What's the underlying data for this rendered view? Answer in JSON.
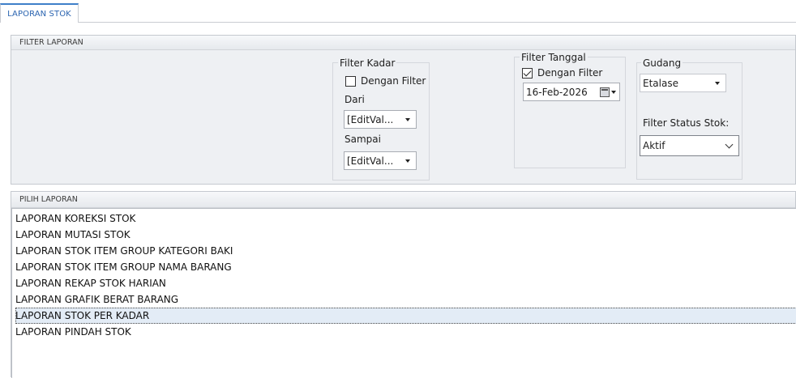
{
  "tab": {
    "label": "LAPORAN STOK"
  },
  "filter_group": {
    "title": "FILTER LAPORAN",
    "filter_kadar": {
      "legend": "Filter Kadar",
      "checkbox_label": "Dengan Filter",
      "checked": false,
      "dari_label": "Dari",
      "dari_value": "[EditVal...",
      "sampai_label": "Sampai",
      "sampai_value": "[EditVal..."
    },
    "filter_tanggal": {
      "legend": "Filter Tanggal",
      "checkbox_label": "Dengan Filter",
      "checked": true,
      "date_value": "16-Feb-2026"
    },
    "gudang": {
      "legend": "Gudang",
      "value": "Etalase",
      "status_label": "Filter Status Stok:",
      "status_value": "Aktif"
    }
  },
  "report_group": {
    "title": "PILIH LAPORAN",
    "items": [
      "LAPORAN KOREKSI STOK",
      "LAPORAN MUTASI STOK",
      "LAPORAN STOK ITEM GROUP KATEGORI BAKI",
      "LAPORAN STOK ITEM GROUP NAMA BARANG",
      "LAPORAN REKAP STOK HARIAN",
      "LAPORAN GRAFIK BERAT BARANG",
      "LAPORAN STOK PER KADAR",
      "LAPORAN PINDAH STOK"
    ],
    "selected_index": 6
  },
  "colors": {
    "accent": "#3f7fc9",
    "selection": "#e3ecf6",
    "panel": "#eef0f3"
  }
}
